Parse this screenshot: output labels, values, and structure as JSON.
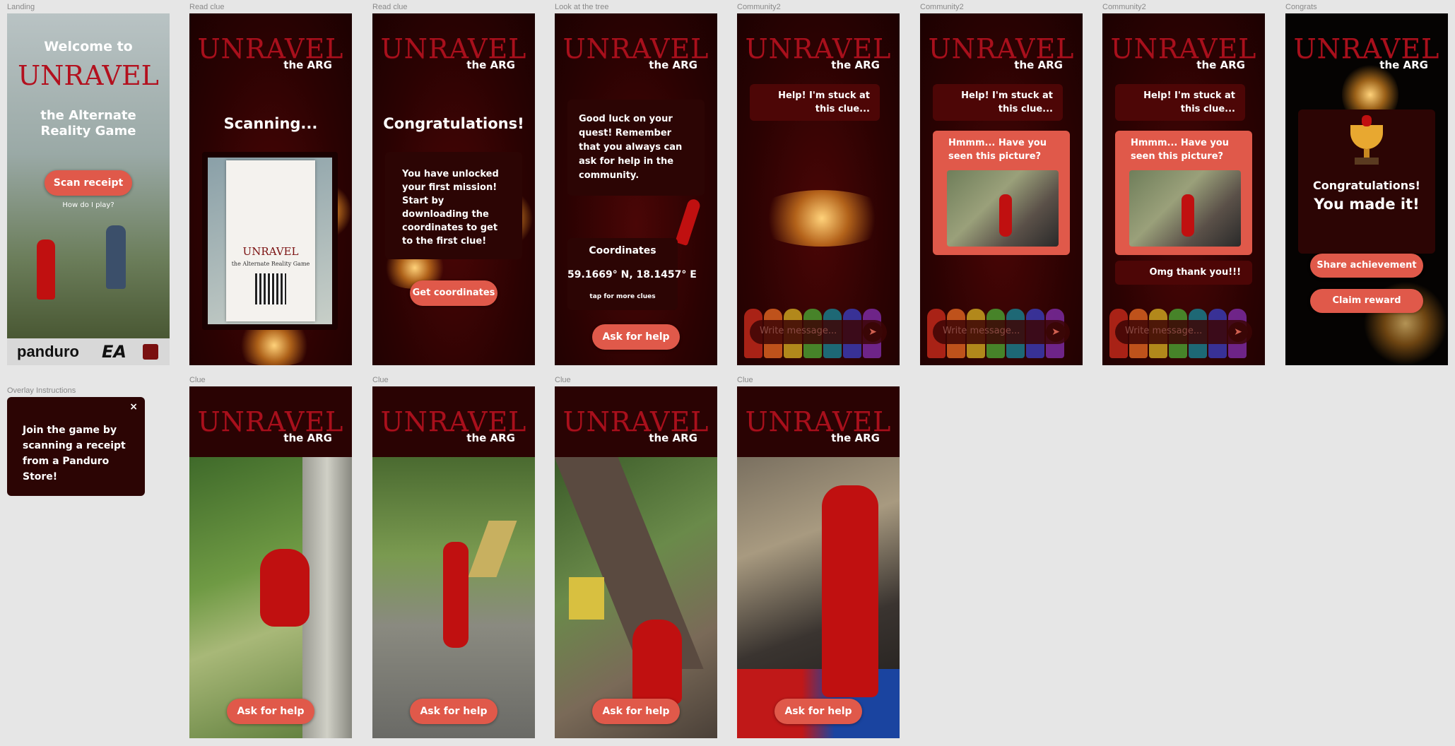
{
  "frames": {
    "landing": {
      "label": "Landing",
      "welcome": "Welcome to",
      "brand": "UNRAVEL",
      "subtitle": "the Alternate Reality Game",
      "scan_button": "Scan receipt",
      "how_link": "How do I play?",
      "footer_brand": "panduro",
      "footer_ea": "EA"
    },
    "read_clue_1": {
      "label": "Read clue",
      "heading": "Scanning...",
      "receipt_brand": "UNRAVEL",
      "receipt_sub": "the Alternate Reality Game"
    },
    "read_clue_2": {
      "label": "Read clue",
      "heading": "Congratulations!",
      "body": "You have unlocked your first mission! Start by downloading the coordinates to get to the first clue!",
      "button": "Get coordinates"
    },
    "look_at_tree": {
      "label": "Look at the tree",
      "message": "Good luck on your quest! Remember that you always can ask for help in the community.",
      "coords_title": "Coordinates",
      "coords_value": "59.1669° N, 18.1457° E",
      "coords_hint": "tap for more clues",
      "button": "Ask for help"
    },
    "community_1": {
      "label": "Community2",
      "user_msg": "Help! I'm stuck at this clue...",
      "input_placeholder": "Write message..."
    },
    "community_2": {
      "label": "Community2",
      "user_msg": "Help! I'm stuck at this clue...",
      "reply": "Hmmm... Have you seen this picture?",
      "input_placeholder": "Write message..."
    },
    "community_3": {
      "label": "Community2",
      "user_msg": "Help! I'm stuck at this clue...",
      "reply": "Hmmm... Have you seen this picture?",
      "thanks": "Omg thank you!!!",
      "input_placeholder": "Write message..."
    },
    "congrats": {
      "label": "Congrats",
      "line1": "Congratulations!",
      "line2": "You made it!",
      "share_button": "Share achievement",
      "claim_button": "Claim reward"
    },
    "overlay": {
      "label": "Overlay Instructions",
      "text": "Join the game by scanning a receipt from a Panduro Store!",
      "close": "×"
    },
    "clues": [
      {
        "label": "Clue",
        "button": "Ask for help"
      },
      {
        "label": "Clue",
        "button": "Ask for help"
      },
      {
        "label": "Clue",
        "button": "Ask for help"
      },
      {
        "label": "Clue",
        "button": "Ask for help"
      }
    ],
    "logo": {
      "brand": "UNRAVEL",
      "tag": "the ARG"
    }
  },
  "colors": {
    "accent": "#e0594a",
    "dark": "#2a0303",
    "brand_red": "#a8101c",
    "canvas": "#e6e6e6"
  }
}
